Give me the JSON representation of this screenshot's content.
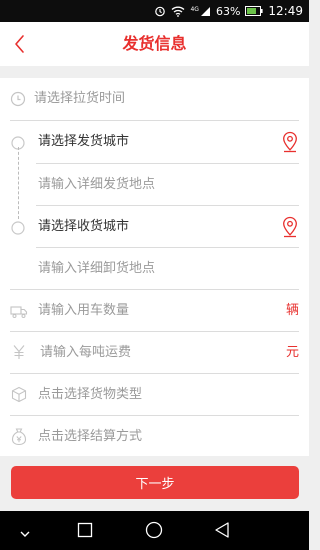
{
  "status_bar": {
    "signal_label": "4G",
    "battery": "63%",
    "time": "12:49"
  },
  "header": {
    "title": "发货信息"
  },
  "form": {
    "rows": [
      {
        "label": "请选择拉货时间"
      },
      {
        "label": "请选择发货城市"
      },
      {
        "label": "请输入详细发货地点"
      },
      {
        "label": "请选择收货城市"
      },
      {
        "label": "请输入详细卸货地点"
      },
      {
        "label": "请输入用车数量",
        "unit": "辆"
      },
      {
        "label": "请输入每吨运费",
        "unit": "元"
      },
      {
        "label": "点击选择货物类型"
      },
      {
        "label": "点击选择结算方式"
      }
    ]
  },
  "next_button": {
    "label": "下一步"
  },
  "colors": {
    "accent": "#e8302e",
    "button": "#eb3f3c"
  }
}
